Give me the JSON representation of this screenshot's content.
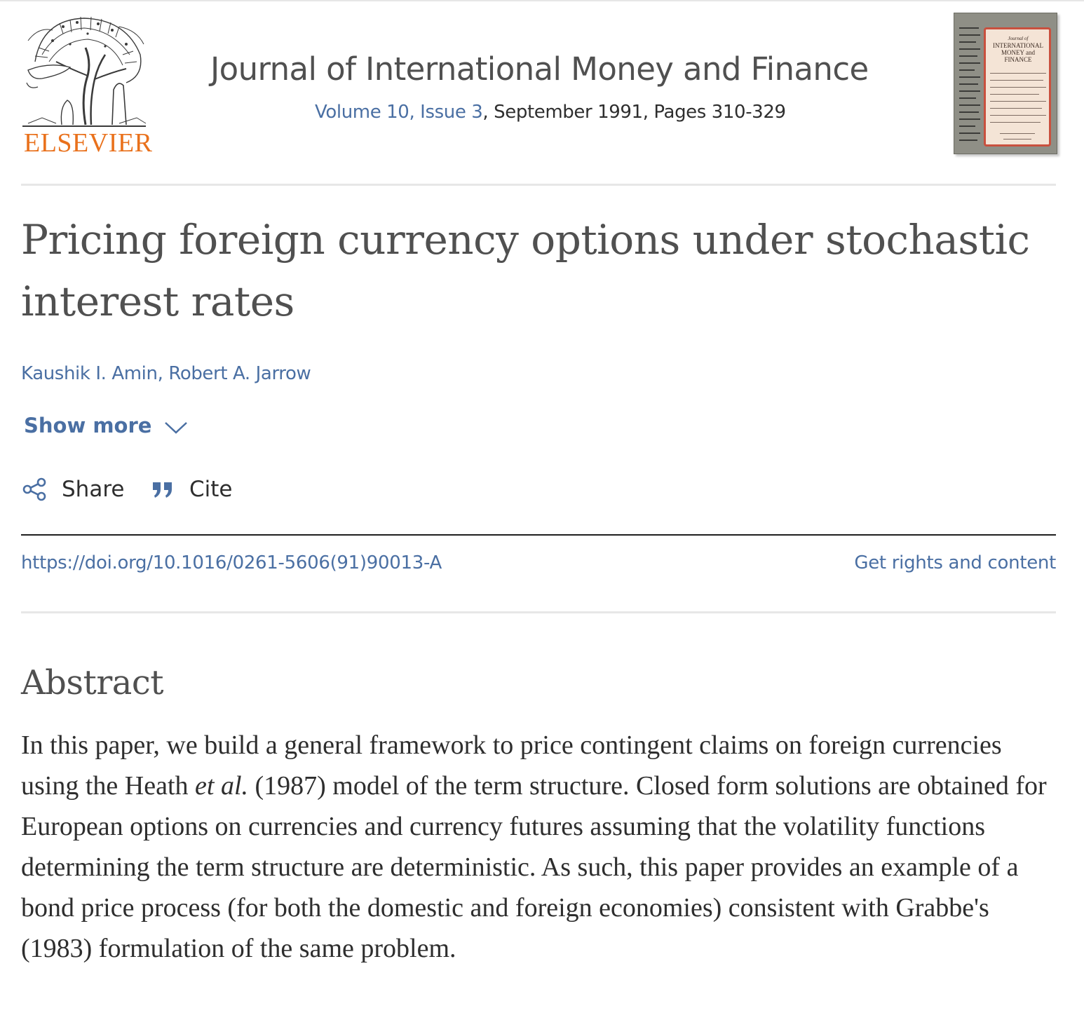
{
  "header": {
    "publisher_logo_text": "ELSEVIER",
    "journal_title": "Journal of International Money and Finance",
    "volume_issue_link": "Volume 10, Issue 3",
    "issue_details": ", September 1991, Pages 310-329",
    "cover_title": "INTERNATIONAL MONEY and FINANCE",
    "cover_journal_prefix": "Journal of"
  },
  "article": {
    "title": "Pricing foreign currency options under stochastic interest rates",
    "authors": [
      {
        "name": "Kaushik I. Amin"
      },
      {
        "name": "Robert A. Jarrow"
      }
    ],
    "author_separator": ", ",
    "show_more_label": "Show more",
    "actions": {
      "share_label": "Share",
      "cite_label": "Cite"
    },
    "doi": "https://doi.org/10.1016/0261-5606(91)90013-A",
    "rights_label": "Get rights and content"
  },
  "abstract": {
    "heading": "Abstract",
    "text_before_italic": "In this paper, we build a general framework to price contingent claims on foreign currencies using the Heath ",
    "italic": "et al.",
    "text_after_italic": " (1987) model of the term structure. Closed form solutions are obtained for European options on currencies and currency futures assuming that the volatility functions determining the term structure are deterministic. As such, this paper provides an example of a bond price process (for both the domestic and foreign economies) consistent with Grabbe's (1983) formulation of the same problem."
  },
  "colors": {
    "link": "#4a6fa3",
    "elsevier_orange": "#e9711c",
    "title_gray": "#505050",
    "text": "#2e2e2e"
  },
  "icons": {
    "share": "share-icon",
    "cite": "quote-icon",
    "show_more": "chevron-down-icon"
  }
}
